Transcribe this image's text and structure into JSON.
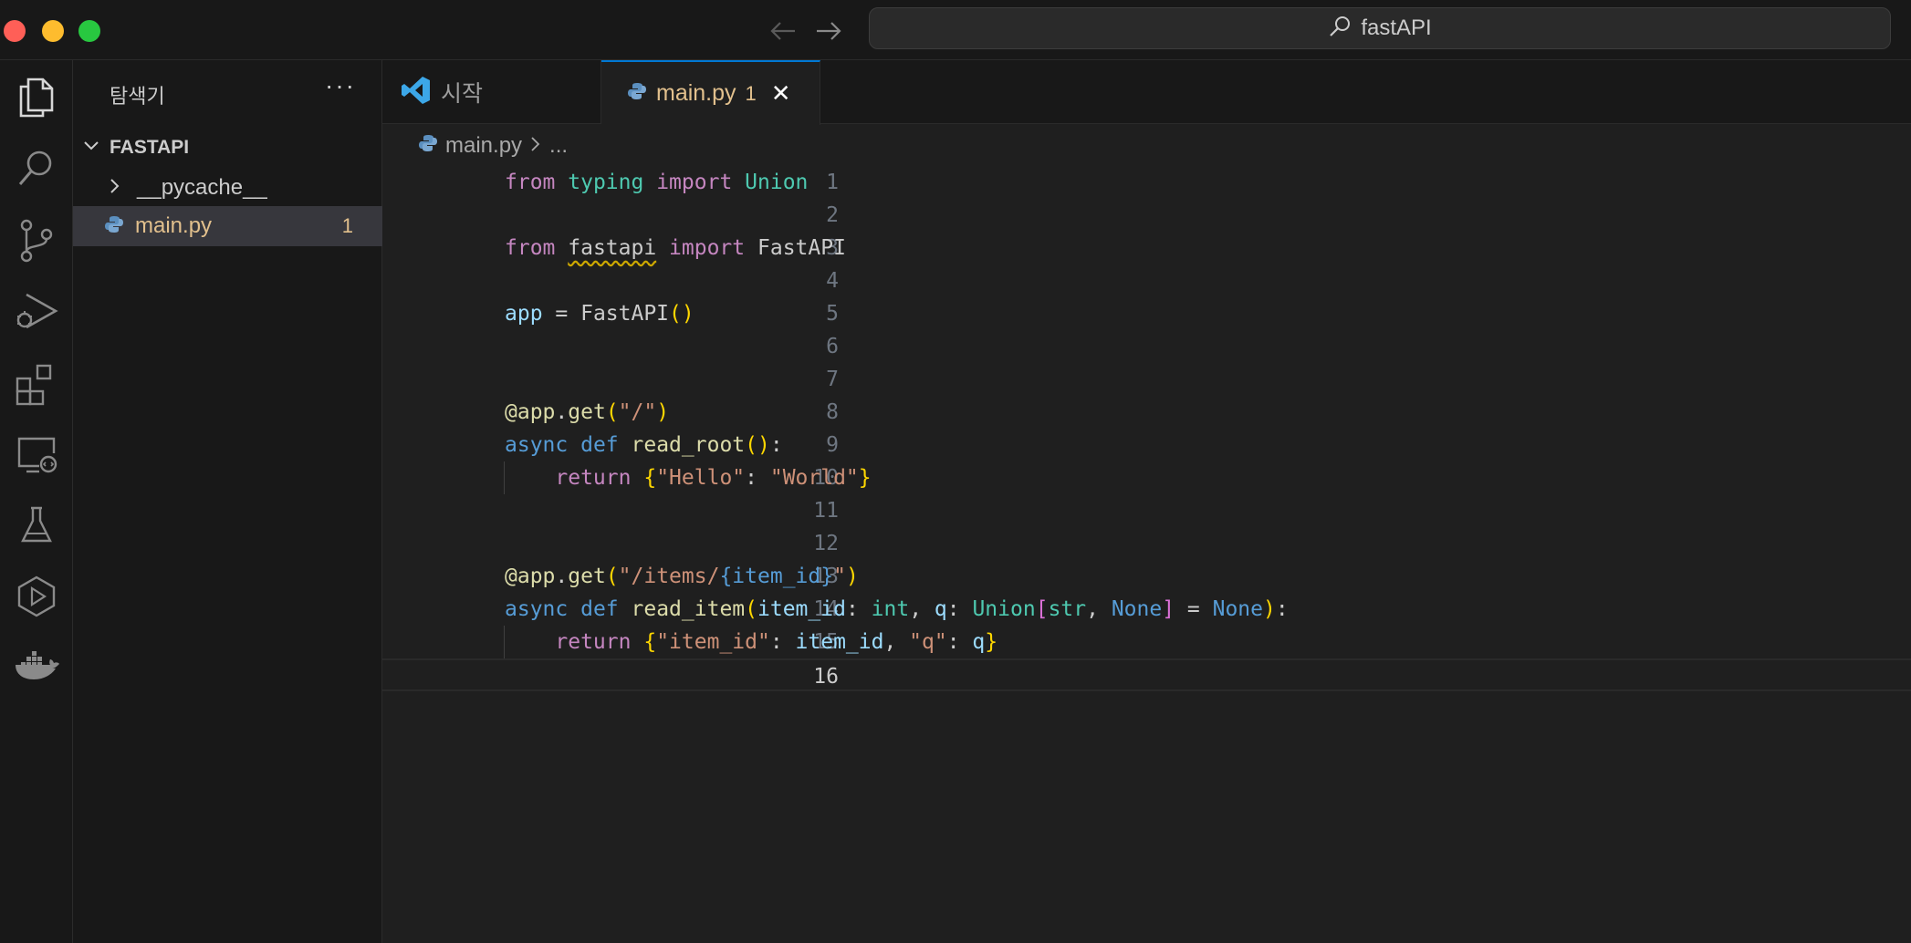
{
  "titlebar": {
    "search_text": "fastAPI"
  },
  "activity_bar": {
    "icons": [
      "explorer-icon",
      "search-icon",
      "source-control-icon",
      "run-debug-icon",
      "extensions-icon",
      "remote-explorer-icon",
      "testing-icon",
      "deploy-icon",
      "docker-icon"
    ]
  },
  "sidebar": {
    "title": "탐색기",
    "more": "···",
    "folder": "FASTAPI",
    "items": [
      {
        "label": "__pycache__",
        "type": "folder"
      },
      {
        "label": "main.py",
        "type": "file",
        "count": "1"
      }
    ]
  },
  "tabs": [
    {
      "label": "시작"
    },
    {
      "label": "main.py",
      "badge": "1"
    }
  ],
  "breadcrumb": {
    "file": "main.py",
    "rest": "..."
  },
  "editor": {
    "lines": [
      "from typing import Union",
      "",
      "from fastapi import FastAPI",
      "",
      "app = FastAPI()",
      "",
      "",
      "@app.get(\"/\")",
      "async def read_root():",
      "    return {\"Hello\": \"World\"}",
      "",
      "",
      "@app.get(\"/items/{item_id}\")",
      "async def read_item(item_id: int, q: Union[str, None] = None):",
      "    return {\"item_id\": item_id, \"q\": q}",
      ""
    ],
    "current_line": 16
  },
  "colors": {
    "accent": "#0078d4",
    "modified": "#e2c08d",
    "background": "#1f1f1f"
  }
}
